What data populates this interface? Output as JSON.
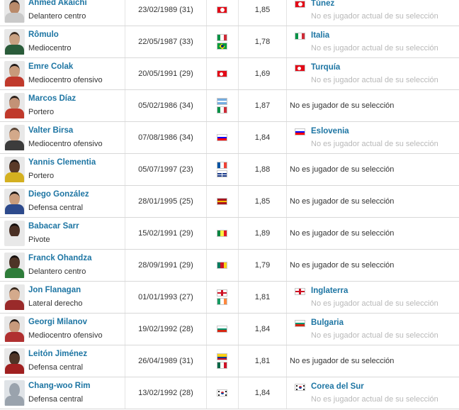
{
  "players": [
    {
      "name": "Ahmed Akaichi",
      "position": "Delantero centro",
      "dob": "23/02/1989 (31)",
      "flags": [
        "tn"
      ],
      "height": "1,85",
      "nt_name": "Túnez",
      "nt_flag": "tn",
      "nt_note": "No es jugador actual de su selección",
      "skin": "#b98a6a",
      "shirt": "#c9c9c9",
      "hair": "#2a2220"
    },
    {
      "name": "Rômulo",
      "position": "Mediocentro",
      "dob": "22/05/1987 (33)",
      "flags": [
        "it",
        "br"
      ],
      "height": "1,78",
      "nt_name": "Italia",
      "nt_flag": "it",
      "nt_note": "No es jugador actual de su selección",
      "skin": "#c9a081",
      "shirt": "#2a5c3a",
      "hair": "#3a2a20"
    },
    {
      "name": "Emre Colak",
      "position": "Mediocentro ofensivo",
      "dob": "20/05/1991 (29)",
      "flags": [
        "tr"
      ],
      "height": "1,69",
      "nt_name": "Turquía",
      "nt_flag": "tr",
      "nt_note": "No es jugador actual de su selección",
      "skin": "#c89a7a",
      "shirt": "#c0392b",
      "hair": "#221a18"
    },
    {
      "name": "Marcos Díaz",
      "position": "Portero",
      "dob": "05/02/1986 (34)",
      "flags": [
        "ar",
        "it"
      ],
      "height": "1,87",
      "nt_plain": "No es jugador de su selección",
      "skin": "#c39276",
      "shirt": "#c0392b",
      "hair": "#2a1e18"
    },
    {
      "name": "Valter Birsa",
      "position": "Mediocentro ofensivo",
      "dob": "07/08/1986 (34)",
      "flags": [
        "si"
      ],
      "height": "1,84",
      "nt_name": "Eslovenia",
      "nt_flag": "si",
      "nt_note": "No es jugador actual de su selección",
      "skin": "#d3a98a",
      "shirt": "#3c3c3c",
      "hair": "#5a4434"
    },
    {
      "name": "Yannis Clementia",
      "position": "Portero",
      "dob": "05/07/1997 (23)",
      "flags": [
        "fr",
        "gp"
      ],
      "height": "1,88",
      "nt_plain": "No es jugador de su selección",
      "skin": "#5a3a28",
      "shirt": "#d4b020",
      "hair": "#1a1210"
    },
    {
      "name": "Diego González",
      "position": "Defensa central",
      "dob": "28/01/1995 (25)",
      "flags": [
        "es"
      ],
      "height": "1,85",
      "nt_plain": "No es jugador de su selección",
      "skin": "#c99c7c",
      "shirt": "#2d4a8c",
      "hair": "#1e1612"
    },
    {
      "name": "Babacar Sarr",
      "position": "Pivote",
      "dob": "15/02/1991 (29)",
      "flags": [
        "sn"
      ],
      "height": "1,89",
      "nt_plain": "No es jugador de su selección",
      "skin": "#4a3024",
      "shirt": "#e8e8e8",
      "hair": "#140e0c"
    },
    {
      "name": "Franck Ohandza",
      "position": "Delantero centro",
      "dob": "28/09/1991 (29)",
      "flags": [
        "cm"
      ],
      "height": "1,79",
      "nt_plain": "No es jugador de su selección",
      "skin": "#4e3426",
      "shirt": "#2f7d3a",
      "hair": "#140e0c"
    },
    {
      "name": "Jon Flanagan",
      "position": "Lateral derecho",
      "dob": "01/01/1993 (27)",
      "flags": [
        "gb-eng",
        "ie"
      ],
      "height": "1,81",
      "nt_name": "Inglaterra",
      "nt_flag": "gb-eng",
      "nt_note": "No es jugador actual de su selección",
      "skin": "#d4aa8c",
      "shirt": "#9a2a2a",
      "hair": "#3a2a1e"
    },
    {
      "name": "Georgi Milanov",
      "position": "Mediocentro ofensivo",
      "dob": "19/02/1992 (28)",
      "flags": [
        "bg"
      ],
      "height": "1,84",
      "nt_name": "Bulgaria",
      "nt_flag": "bg",
      "nt_note": "No es jugador actual de su selección",
      "skin": "#c89a7c",
      "shirt": "#b03030",
      "hair": "#2a1e18"
    },
    {
      "name": "Leitón Jiménez",
      "position": "Defensa central",
      "dob": "26/04/1989 (31)",
      "flags": [
        "co",
        "mx"
      ],
      "height": "1,81",
      "nt_plain": "No es jugador de su selección",
      "skin": "#4e3426",
      "shirt": "#a02020",
      "hair": "#140e0c"
    },
    {
      "name": "Chang-woo Rim",
      "position": "Defensa central",
      "dob": "13/02/1992 (28)",
      "flags": [
        "kr"
      ],
      "height": "1,84",
      "nt_name": "Corea del Sur",
      "nt_flag": "kr",
      "nt_note": "No es jugador actual de su selección",
      "photo_placeholder": true,
      "skin": "#9aa3ad",
      "shirt": "#9aa3ad",
      "hair": "#9aa3ad"
    }
  ]
}
